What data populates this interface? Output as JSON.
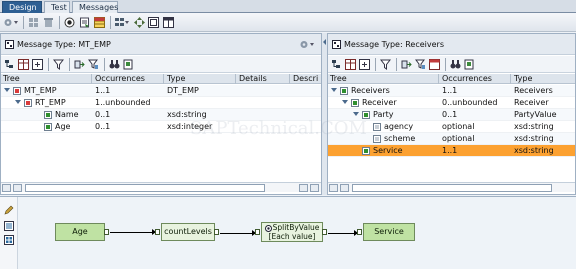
{
  "tabs": [
    {
      "label": "Design",
      "active": true
    },
    {
      "label": "Test",
      "active": false
    },
    {
      "label": "Messages",
      "active": false
    }
  ],
  "left_pane": {
    "title": "Message Type: MT_EMP",
    "columns": [
      "Tree",
      "Occurrences",
      "Type",
      "Details",
      "Descri"
    ],
    "rows": [
      {
        "name": "MT_EMP",
        "occ": "1..1",
        "type": "DT_EMP"
      },
      {
        "name": "RT_EMP",
        "occ": "1..unbounded",
        "type": ""
      },
      {
        "name": "Name",
        "occ": "0..1",
        "type": "xsd:string"
      },
      {
        "name": "Age",
        "occ": "0..1",
        "type": "xsd:integer"
      }
    ]
  },
  "right_pane": {
    "title": "Message Type: Receivers",
    "columns": [
      "Tree",
      "Occurrences",
      "Type"
    ],
    "rows": [
      {
        "name": "Receivers",
        "occ": "1..1",
        "type": "Receivers"
      },
      {
        "name": "Receiver",
        "occ": "0..unbounded",
        "type": "Receiver"
      },
      {
        "name": "Party",
        "occ": "0..1",
        "type": "PartyValue"
      },
      {
        "name": "agency",
        "occ": "optional",
        "type": "xsd:string"
      },
      {
        "name": "scheme",
        "occ": "optional",
        "type": "xsd:string"
      },
      {
        "name": "Service",
        "occ": "1..1",
        "type": "xsd:string"
      }
    ]
  },
  "mapping": {
    "source": "Age",
    "func1": "countLevels",
    "func2_line1": "SplitByValue",
    "func2_line2": "[Each value]",
    "target": "Service"
  },
  "watermark": "SAPTechnical.COM",
  "colors": {
    "selection": "#fca131",
    "node_green": "#bfe2a3",
    "tab_active": "#2d5f93"
  }
}
